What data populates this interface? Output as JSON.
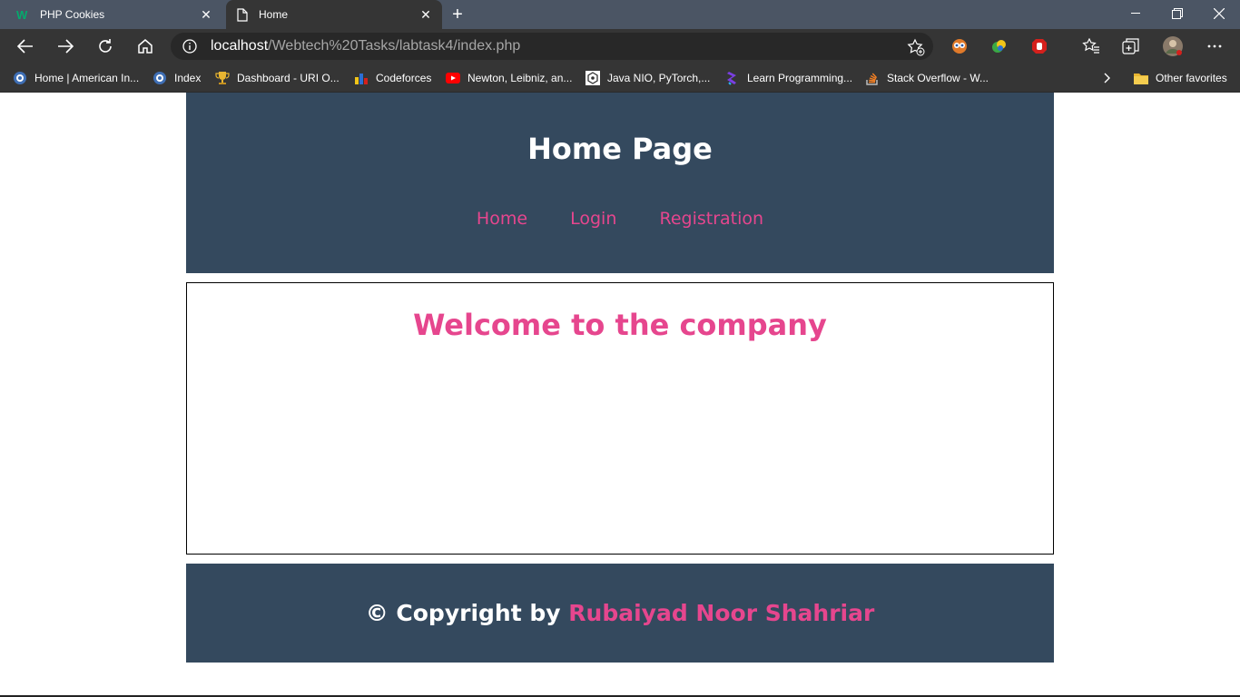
{
  "browser": {
    "tabs": [
      {
        "title": "PHP Cookies",
        "active": false,
        "icon": "w3schools-icon"
      },
      {
        "title": "Home",
        "active": true,
        "icon": "document-icon"
      }
    ],
    "address": {
      "host": "localhost",
      "path": "/Webtech%20Tasks/labtask4/index.php"
    },
    "bookmarks": [
      {
        "label": "Home | American In...",
        "icon": "shield-globe-icon"
      },
      {
        "label": "Index",
        "icon": "shield-globe-icon"
      },
      {
        "label": "Dashboard - URI O...",
        "icon": "trophy-icon"
      },
      {
        "label": "Codeforces",
        "icon": "bar-chart-icon"
      },
      {
        "label": "Newton, Leibniz, an...",
        "icon": "youtube-icon"
      },
      {
        "label": "Java NIO, PyTorch,...",
        "icon": "hexagon-icon"
      },
      {
        "label": "Learn Programming...",
        "icon": "code-icon"
      },
      {
        "label": "Stack Overflow - W...",
        "icon": "stackoverflow-icon"
      }
    ],
    "other_favorites": "Other favorites",
    "colors": {
      "tabbar": "#4b5564",
      "toolbar": "#353535"
    }
  },
  "page": {
    "title": "Home Page",
    "nav": [
      {
        "label": "Home"
      },
      {
        "label": "Login"
      },
      {
        "label": "Registration"
      }
    ],
    "welcome": "Welcome to the company",
    "footer": {
      "prefix": "© Copyright by ",
      "author": "Rubaiyad Noor Shahriar"
    },
    "colors": {
      "header_bg": "#34495e",
      "accent": "#e6468e",
      "text": "#ffffff"
    }
  }
}
